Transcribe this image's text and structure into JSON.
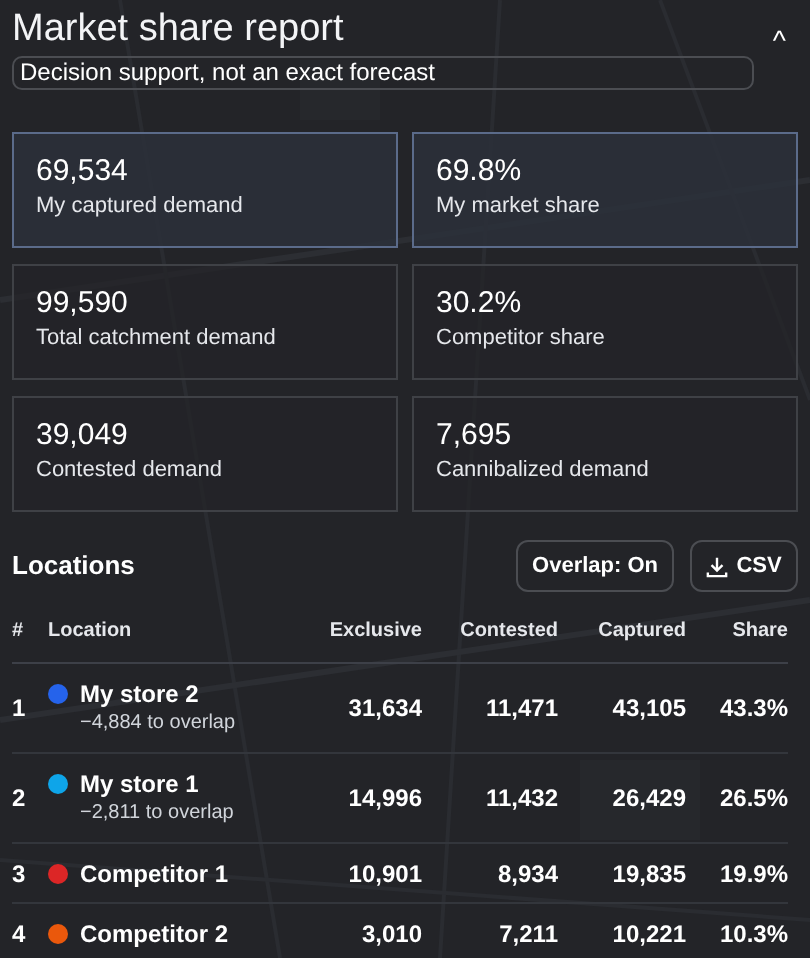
{
  "panel": {
    "title": "Market share report",
    "subtitle": "Decision support, not an exact forecast",
    "collapse_icon": "^"
  },
  "stats": [
    {
      "value": "69,534",
      "label": "My captured demand",
      "highlighted": true
    },
    {
      "value": "69.8%",
      "label": "My market share",
      "highlighted": true
    },
    {
      "value": "99,590",
      "label": "Total catchment demand",
      "highlighted": false
    },
    {
      "value": "30.2%",
      "label": "Competitor share",
      "highlighted": false
    },
    {
      "value": "39,049",
      "label": "Contested demand",
      "highlighted": false
    },
    {
      "value": "7,695",
      "label": "Cannibalized demand",
      "highlighted": false
    }
  ],
  "locations": {
    "title": "Locations",
    "overlap_button": "Overlap: On",
    "csv_button": "CSV",
    "columns": [
      "#",
      "Location",
      "Exclusive",
      "Contested",
      "Captured",
      "Share"
    ],
    "rows": [
      {
        "rank": "1",
        "name": "My store 2",
        "note": "−4,884 to overlap",
        "color": "#2563eb",
        "exclusive": "31,634",
        "contested": "11,471",
        "captured": "43,105",
        "share": "43.3%"
      },
      {
        "rank": "2",
        "name": "My store 1",
        "note": "−2,811 to overlap",
        "color": "#0ea5e9",
        "exclusive": "14,996",
        "contested": "11,432",
        "captured": "26,429",
        "share": "26.5%"
      },
      {
        "rank": "3",
        "name": "Competitor 1",
        "color": "#dc2626",
        "exclusive": "10,901",
        "contested": "8,934",
        "captured": "19,835",
        "share": "19.9%"
      },
      {
        "rank": "4",
        "name": "Competitor 2",
        "color": "#ea580c",
        "exclusive": "3,010",
        "contested": "7,211",
        "captured": "10,221",
        "share": "10.3%"
      }
    ]
  }
}
